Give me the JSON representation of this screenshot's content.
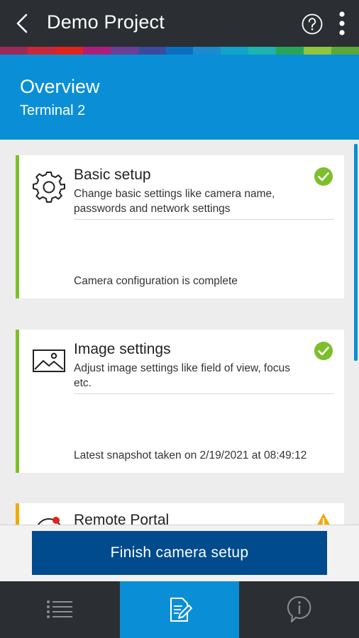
{
  "appbar": {
    "title": "Demo Project"
  },
  "header": {
    "title": "Overview",
    "subtitle": "Terminal 2"
  },
  "cards": [
    {
      "title": "Basic setup",
      "description": "Change basic settings like camera name, passwords and network settings",
      "status": "Camera configuration is complete",
      "icon": "gear-icon",
      "state": "complete"
    },
    {
      "title": "Image settings",
      "description": "Adjust image settings like field of view, focus etc.",
      "status": "Latest snapshot taken on 2/19/2021 at 08:49:12",
      "icon": "image-icon",
      "state": "complete"
    },
    {
      "title": "Remote Portal",
      "icon": "remote-portal-icon",
      "state": "warning"
    }
  ],
  "footer": {
    "finish_label": "Finish camera setup"
  },
  "bottom_nav": [
    {
      "icon": "list-icon",
      "active": false
    },
    {
      "icon": "edit-document-icon",
      "active": true
    },
    {
      "icon": "info-icon",
      "active": false
    }
  ],
  "colors": {
    "appbar": "#2b2f33",
    "header": "#0a8fd6",
    "primary_button": "#004b8d",
    "success": "#7dbf2a",
    "warning": "#f2a900",
    "supergraphic": [
      "#9e2a5a",
      "#c8283c",
      "#e2231a",
      "#b01e7c",
      "#6b3f98",
      "#3b4ba0",
      "#0a6fc2",
      "#1c8ad0",
      "#11a3c8",
      "#1cb3b0",
      "#27a65a",
      "#8ec63f",
      "#5aa83a"
    ]
  }
}
